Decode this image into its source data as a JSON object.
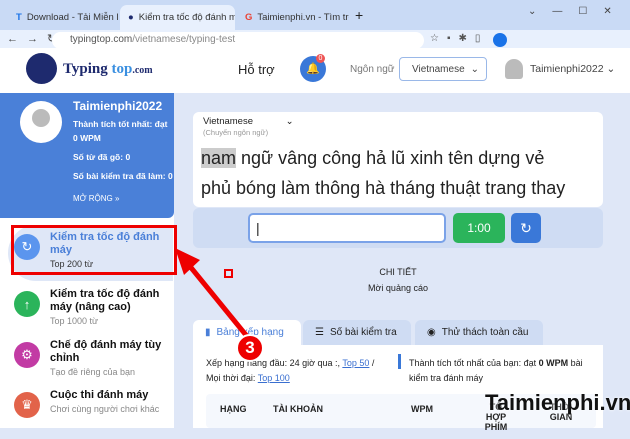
{
  "browser": {
    "tabs": [
      {
        "title": "Download - Tải Miễn Phí VN - Ph"
      },
      {
        "title": "Kiểm tra tốc độ đánh máy tiếng V"
      },
      {
        "title": "Taimienphi.vn - Tìm trên Google"
      }
    ],
    "url_host": "typingtop.com",
    "url_path": "/vietnamese/typing-test"
  },
  "header": {
    "logo_main": "Typing",
    "logo_accent": "top",
    "logo_suffix": ".com",
    "support": "Hỗ trợ",
    "notif_count": "0",
    "lang_label": "Ngôn ngữ",
    "lang_value": "Vietnamese",
    "username": "Taimienphi2022"
  },
  "profile": {
    "name": "Taimienphi2022",
    "best_label": "Thành tích tốt nhất: đạt",
    "best_value": "0 WPM",
    "words_label": "Số từ đã gõ:",
    "words_value": "0",
    "tests_label": "Số bài kiểm tra đã làm:",
    "tests_value": "0",
    "expand": "MỞ RỘNG"
  },
  "menu": [
    {
      "title": "Kiểm tra tốc độ đánh máy",
      "sub": "Top 200 từ",
      "color": "#5b95ee",
      "icon": "timer-icon"
    },
    {
      "title": "Kiểm tra tốc độ đánh máy (nâng cao)",
      "sub": "Top 1000 từ",
      "color": "#2bb45b",
      "icon": "arrow-up-icon"
    },
    {
      "title": "Chế độ đánh máy tùy chỉnh",
      "sub": "Tạo đề riêng của bạn",
      "color": "#c23ba4",
      "icon": "gear-icon"
    },
    {
      "title": "Cuộc thi đánh máy",
      "sub": "Chơi cùng người chơi khác",
      "color": "#e2634a",
      "icon": "trophy-icon"
    }
  ],
  "test": {
    "lang": "Vietnamese",
    "lang_hint": "(Chuyển ngôn ngữ)",
    "current_word": "nam",
    "line1_rest": " ngữ vâng công hả lũ xinh tên dựng vẻ",
    "line2": "phủ bóng làm thông hà tháng thuật trang thay",
    "timer": "1:00"
  },
  "ad": {
    "title": "CHI TIẾT",
    "sub": "Mời quảng cáo"
  },
  "tabs": [
    "Bảng xếp hạng",
    "Số bài kiểm tra",
    "Thử thách toàn cầu"
  ],
  "board": {
    "rank_text": "Xếp hạng hàng đầu: 24 giờ qua :,",
    "top50": "Top 50",
    "sep": "/ Mọi thời đại:",
    "top100": "Top 100",
    "best_pre": "Thành tích tốt nhất của bạn: đạt",
    "best_val": "0 WPM",
    "best_post": "bài kiểm tra đánh máy",
    "columns": [
      "HẠNG",
      "TÀI KHOẢN",
      "WPM",
      "TỔ HỢP PHÍM",
      "THỜI GIAN"
    ]
  },
  "annotation": {
    "step": "3"
  },
  "watermark": "Taimienphi.vn"
}
